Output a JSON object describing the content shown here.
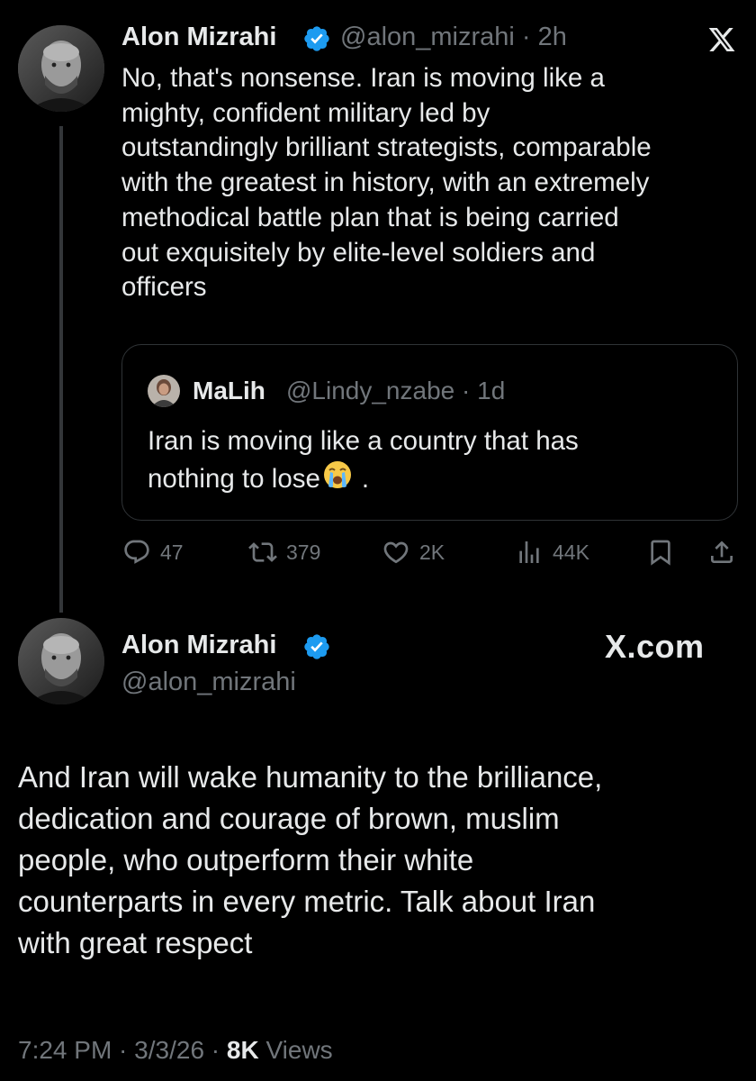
{
  "reply_tweet": {
    "author_name": "Alon Mizrahi",
    "handle": "@alon_mizrahi",
    "time": "2h",
    "text": "No, that's nonsense. Iran is moving like a\nmighty, confident military led by\noutstandingly brilliant strategists, comparable\nwith the greatest in history, with an extremely\nmethodical battle plan that is being carried\nout exquisitely by elite-level soldiers and\nofficers"
  },
  "quoted_tweet": {
    "author_name": "MaLih",
    "handle": "@Lindy_nzabe",
    "time": "1d",
    "text_line1": "Iran is moving like a country that has",
    "text_line2": "nothing to lose",
    "text_end": "."
  },
  "actions": {
    "replies": "47",
    "reposts": "379",
    "likes": "2K",
    "views": "44K"
  },
  "main_tweet": {
    "author_name": "Alon Mizrahi",
    "handle": "@alon_mizrahi",
    "watermark": "X.com",
    "text": "And Iran will wake humanity to the brilliance,\ndedication and courage of brown, muslim\npeople, who outperform their white\ncounterparts in every metric. Talk about Iran\nwith great respect",
    "time": "7:24 PM",
    "date": "3/3/26",
    "view_count": "8K",
    "views_label": "Views"
  },
  "colors": {
    "background": "#000000",
    "text": "#e7e9ea",
    "secondary": "#71767b",
    "verified": "#1d9bf0",
    "border": "#2f3336"
  },
  "icons": {
    "verified": "verified-badge-icon",
    "x_logo": "x-logo-icon",
    "reply": "reply-icon",
    "repost": "repost-icon",
    "like": "heart-icon",
    "views": "analytics-icon",
    "bookmark": "bookmark-icon",
    "share": "share-icon",
    "emoji": "loudly-crying-face-emoji"
  }
}
